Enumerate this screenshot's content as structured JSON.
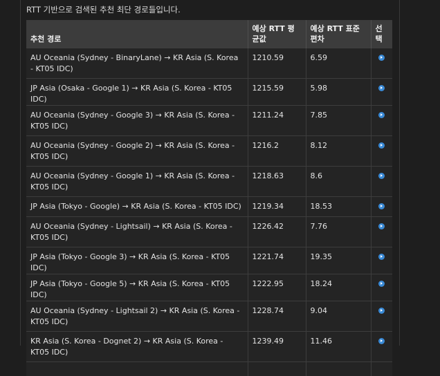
{
  "caption": "RTT 기반으로 검색된 추천 최단 경로들입니다.",
  "table": {
    "headers": {
      "route": "추천 경로",
      "mean": "예상 RTT 평균값",
      "std": "예상 RTT 표준편차",
      "select": "선택"
    },
    "rows": [
      {
        "route": "AU Oceania (Sydney - BinaryLane) → KR Asia (S. Korea - KT05 IDC)",
        "mean": "1210.59",
        "std": "6.59"
      },
      {
        "route": "JP Asia (Osaka - Google 1) → KR Asia (S. Korea - KT05 IDC)",
        "mean": "1215.59",
        "std": "5.98"
      },
      {
        "route": "AU Oceania (Sydney - Google 3) → KR Asia (S. Korea - KT05 IDC)",
        "mean": "1211.24",
        "std": "7.85"
      },
      {
        "route": "AU Oceania (Sydney - Google 2) → KR Asia (S. Korea - KT05 IDC)",
        "mean": "1216.2",
        "std": "8.12"
      },
      {
        "route": "AU Oceania (Sydney - Google 1) → KR Asia (S. Korea - KT05 IDC)",
        "mean": "1218.63",
        "std": "8.6"
      },
      {
        "route": "JP Asia (Tokyo - Google) → KR Asia (S. Korea - KT05 IDC)",
        "mean": "1219.34",
        "std": "18.53"
      },
      {
        "route": "AU Oceania (Sydney - Lightsail) → KR Asia (S. Korea - KT05 IDC)",
        "mean": "1226.42",
        "std": "7.76"
      },
      {
        "route": "JP Asia (Tokyo - Google 3) → KR Asia (S. Korea - KT05 IDC)",
        "mean": "1221.74",
        "std": "19.35"
      },
      {
        "route": "JP Asia (Tokyo - Google 5) → KR Asia (S. Korea - KT05 IDC)",
        "mean": "1222.95",
        "std": "18.24"
      },
      {
        "route": "AU Oceania (Sydney - Lightsail 2) → KR Asia (S. Korea - KT05 IDC)",
        "mean": "1228.74",
        "std": "9.04"
      },
      {
        "route": "KR Asia (S. Korea - Dognet 2) → KR Asia (S. Korea - KT05 IDC)",
        "mean": "1239.49",
        "std": "11.46"
      }
    ]
  },
  "icons": {
    "select": "play-circle-icon"
  },
  "colors": {
    "background": "#1e1e1e",
    "header": "#3c3c3c",
    "row": "#242424",
    "accent": "#3a8ad6"
  }
}
